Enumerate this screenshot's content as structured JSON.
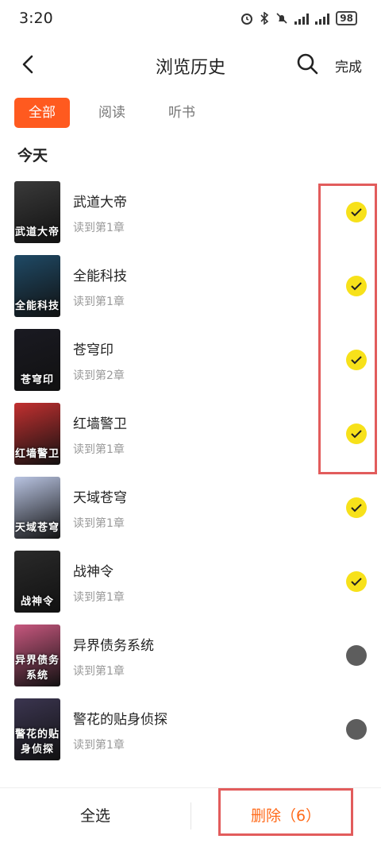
{
  "status": {
    "time": "3:20",
    "battery": "98"
  },
  "header": {
    "title": "浏览历史",
    "done_label": "完成"
  },
  "tabs": [
    {
      "label": "全部",
      "active": true
    },
    {
      "label": "阅读",
      "active": false
    },
    {
      "label": "听书",
      "active": false
    }
  ],
  "section": {
    "label": "今天"
  },
  "books": [
    {
      "title": "武道大帝",
      "progress": "读到第1章",
      "selected": true,
      "cover_text": "武道大帝",
      "cover_color": "#3a3a3a"
    },
    {
      "title": "全能科技",
      "progress": "读到第1章",
      "selected": true,
      "cover_text": "全能科技",
      "cover_color": "#1f4a66"
    },
    {
      "title": "苍穹印",
      "progress": "读到第2章",
      "selected": true,
      "cover_text": "苍穹印",
      "cover_color": "#1a1a22"
    },
    {
      "title": "红墙警卫",
      "progress": "读到第1章",
      "selected": true,
      "cover_text": "红墙警卫",
      "cover_color": "#c23030"
    },
    {
      "title": "天域苍穹",
      "progress": "读到第1章",
      "selected": true,
      "cover_text": "天域苍穹",
      "cover_color": "#b9c4e2"
    },
    {
      "title": "战神令",
      "progress": "读到第1章",
      "selected": true,
      "cover_text": "战神令",
      "cover_color": "#2a2a2a"
    },
    {
      "title": "异界债务系统",
      "progress": "读到第1章",
      "selected": false,
      "cover_text": "异界债务系统",
      "cover_color": "#c7577e"
    },
    {
      "title": "警花的贴身侦探",
      "progress": "读到第1章",
      "selected": false,
      "cover_text": "警花的贴身侦探",
      "cover_color": "#3b3550"
    }
  ],
  "footer": {
    "select_all_label": "全选",
    "delete_label": "删除（6）"
  },
  "colors": {
    "accent": "#ff5a1f",
    "check_on": "#f7e11a",
    "check_off": "#5d5d5d",
    "delete_text": "#ff6a1a",
    "highlight": "#e25c5c"
  }
}
